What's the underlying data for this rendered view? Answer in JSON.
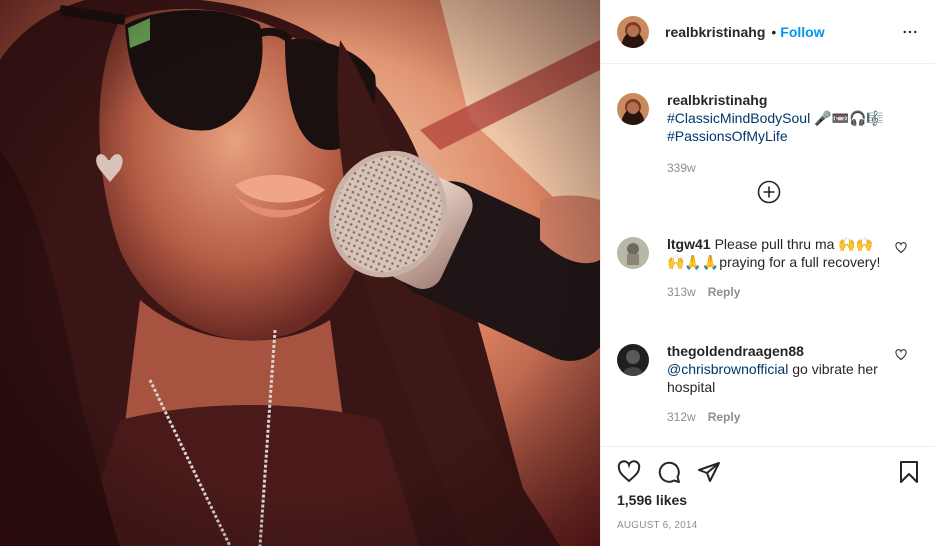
{
  "colors": {
    "link": "#0095f6",
    "hashtag": "#00376b",
    "muted": "#8e8e8e",
    "text": "#262626"
  },
  "header": {
    "username": "realbkristinahg",
    "separator": "•",
    "follow_label": "Follow",
    "more_icon": "more-horizontal-icon"
  },
  "caption": {
    "username": "realbkristinahg",
    "hashtag_1": "#ClassicMindBodySoul",
    "emojis": "🎤📼🎧🎼",
    "hashtag_2": "#PassionsOfMyLife",
    "time": "339w"
  },
  "load_more_icon": "add-circle-icon",
  "comments": [
    {
      "username": "ltgw41",
      "text": "Please pull thru ma 🙌🙌🙌🙏🙏praying for a full recovery!",
      "time": "313w",
      "reply_label": "Reply",
      "like_icon": "heart-outline-icon"
    },
    {
      "username": "thegoldendraagen88",
      "mention": "@chrisbrownofficial",
      "text": " go vibrate her hospital",
      "time": "312w",
      "reply_label": "Reply",
      "like_icon": "heart-outline-icon"
    }
  ],
  "actions": {
    "icons": [
      "heart-icon",
      "comment-icon",
      "share-icon",
      "bookmark-icon"
    ],
    "likes": "1,596 likes",
    "date": "AUGUST 6, 2014"
  }
}
